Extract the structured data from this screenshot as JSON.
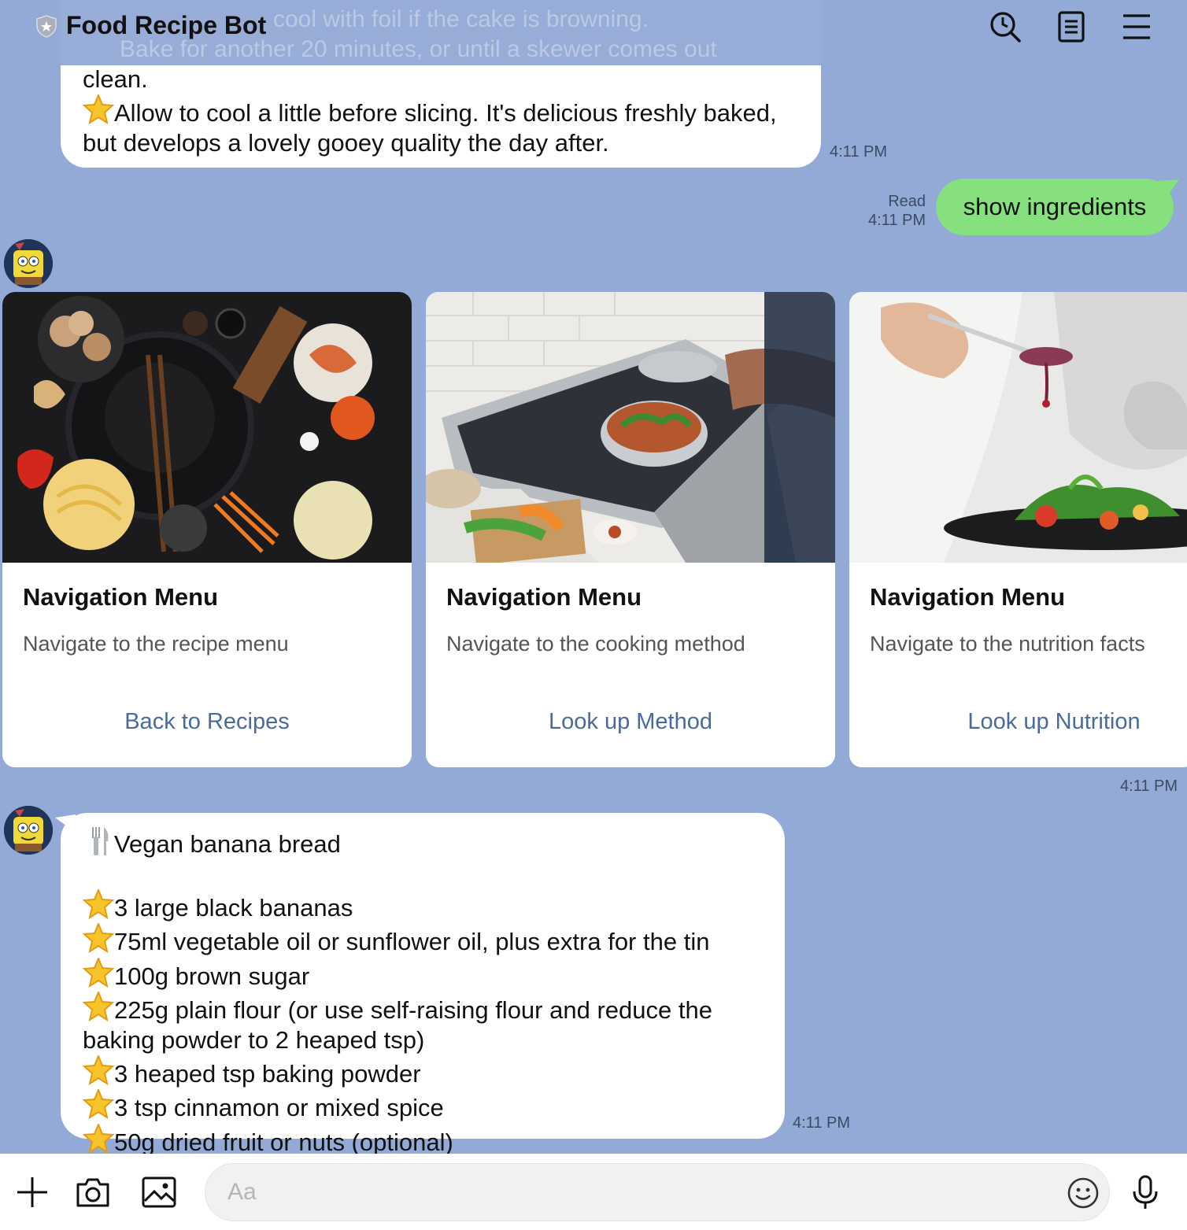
{
  "header": {
    "title": "Food Recipe Bot",
    "icons": [
      "shield-badge-icon",
      "search-icon",
      "notes-icon",
      "menu-icon"
    ]
  },
  "messages": {
    "recipe_method": {
      "faded_line_1": "cool with foil if the cake is browning.",
      "faded_line_2": "Bake for another 20 minutes, or until a skewer comes out",
      "line_clean": "clean.",
      "line_cool": "Allow to cool a little before slicing. It's delicious freshly baked, but develops a lovely gooey quality the day after.",
      "time": "4:11 PM"
    },
    "user": {
      "text": "show ingredients",
      "read_label": "Read",
      "time": "4:11 PM"
    },
    "carousel_time": "4:11 PM",
    "ingredients": {
      "title": "Vegan banana bread",
      "items": [
        "3 large black  bananas",
        "75ml vegetable oil or sunflower oil, plus extra for the tin",
        "100g brown sugar",
        "225g plain flour (or use self-raising flour and reduce the baking powder to 2 heaped tsp)",
        "3 heaped tsp baking powder",
        "3 tsp cinnamon or mixed spice",
        "50g dried fruit or nuts (optional)"
      ],
      "time": "4:11 PM"
    }
  },
  "cards": [
    {
      "title": "Navigation Menu",
      "description": "Navigate to the recipe menu",
      "action": "Back to Recipes",
      "image": "wok-ingredients-photo"
    },
    {
      "title": "Navigation Menu",
      "description": "Navigate to the cooking method",
      "action": "Look up Method",
      "image": "stove-cooking-photo"
    },
    {
      "title": "Navigation Menu",
      "description": "Navigate to the nutrition facts",
      "action": "Look up Nutrition",
      "image": "chef-plating-photo"
    }
  ],
  "input": {
    "placeholder": "Aa",
    "icons": [
      "plus-icon",
      "camera-icon",
      "image-icon",
      "emoji-icon",
      "microphone-icon"
    ]
  },
  "colors": {
    "background": "#92aad5",
    "user_bubble": "#86e07e",
    "card_action": "#4a6b9a"
  }
}
